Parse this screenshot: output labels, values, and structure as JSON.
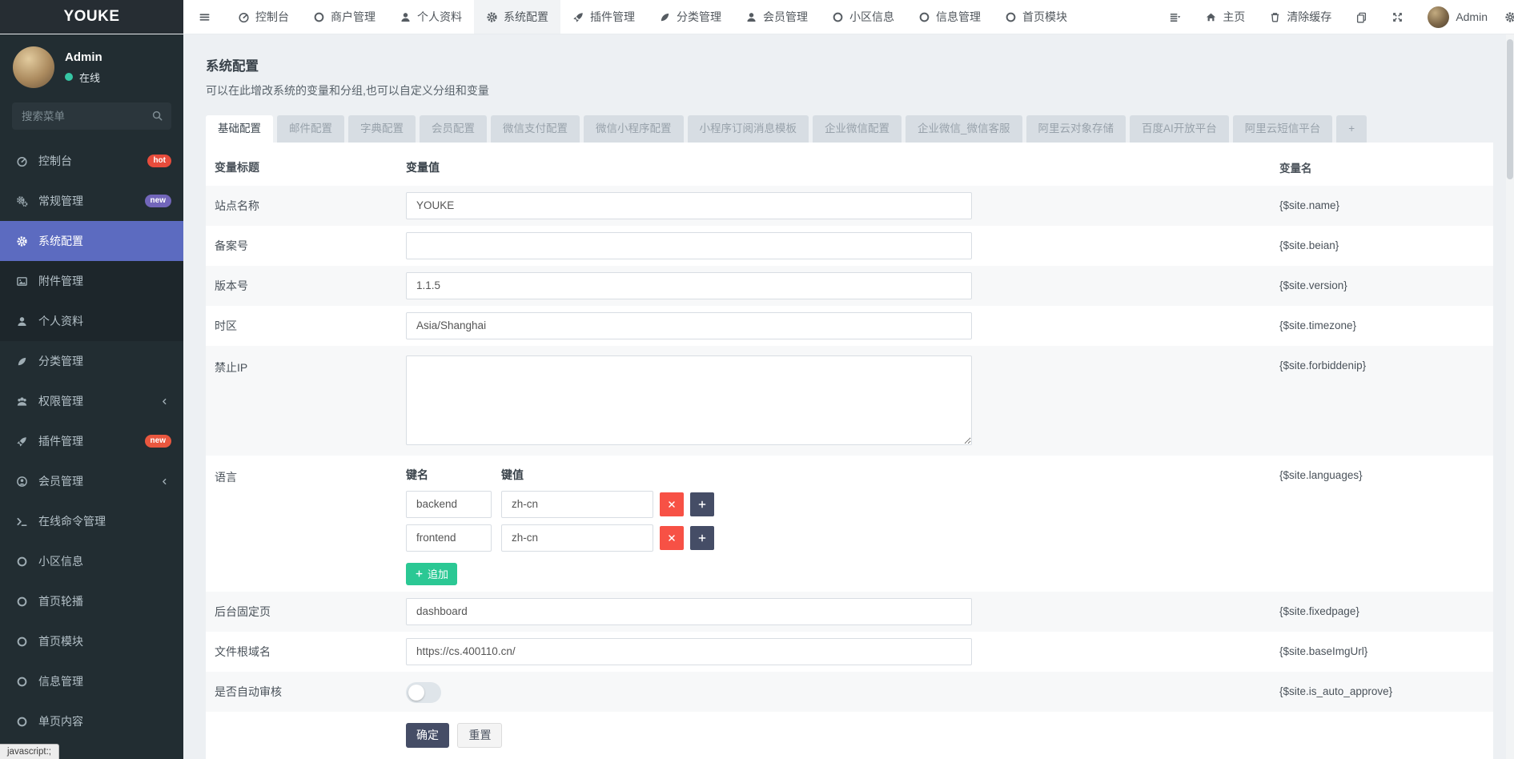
{
  "brand": {
    "title": "YOUKE"
  },
  "topnav": {
    "menu_toggle_icon": "hamburger-icon",
    "tabs": [
      {
        "label": "控制台",
        "icon": "gauge-icon",
        "active": false
      },
      {
        "label": "商户管理",
        "icon": "circle-icon",
        "active": false
      },
      {
        "label": "个人资料",
        "icon": "user-icon",
        "active": false
      },
      {
        "label": "系统配置",
        "icon": "gear-icon",
        "active": true
      },
      {
        "label": "插件管理",
        "icon": "rocket-icon",
        "active": false
      },
      {
        "label": "分类管理",
        "icon": "leaf-icon",
        "active": false
      },
      {
        "label": "会员管理",
        "icon": "user-icon",
        "active": false
      },
      {
        "label": "小区信息",
        "icon": "circle-icon",
        "active": false
      },
      {
        "label": "信息管理",
        "icon": "circle-icon",
        "active": false
      },
      {
        "label": "首页模块",
        "icon": "circle-icon",
        "active": false
      }
    ],
    "right": {
      "home_label": "主页",
      "clear_cache_label": "清除缓存",
      "username": "Admin"
    }
  },
  "sidebar": {
    "user": {
      "name": "Admin",
      "status": "在线"
    },
    "search_placeholder": "搜索菜单",
    "items": [
      {
        "label": "控制台",
        "icon": "gauge-icon",
        "badge": "hot",
        "badge_color": "#e74c3c"
      },
      {
        "label": "常规管理",
        "icon": "gears-icon",
        "badge": "new",
        "badge_color": "#7266ba"
      },
      {
        "label": "系统配置",
        "icon": "gear-icon",
        "active": true,
        "submenu": true
      },
      {
        "label": "附件管理",
        "icon": "picture-icon",
        "submenu": true
      },
      {
        "label": "个人资料",
        "icon": "user-icon",
        "submenu": true
      },
      {
        "label": "分类管理",
        "icon": "leaf-icon"
      },
      {
        "label": "权限管理",
        "icon": "users-icon",
        "chevron": true
      },
      {
        "label": "插件管理",
        "icon": "rocket-icon",
        "badge": "new",
        "badge_color": "#e9573f"
      },
      {
        "label": "会员管理",
        "icon": "user-circle-icon",
        "chevron": true
      },
      {
        "label": "在线命令管理",
        "icon": "terminal-icon"
      },
      {
        "label": "小区信息",
        "icon": "circle-icon"
      },
      {
        "label": "首页轮播",
        "icon": "circle-icon"
      },
      {
        "label": "首页模块",
        "icon": "circle-icon"
      },
      {
        "label": "信息管理",
        "icon": "circle-icon"
      },
      {
        "label": "单页内容",
        "icon": "circle-icon"
      }
    ]
  },
  "page": {
    "title": "系统配置",
    "subtitle": "可以在此增改系统的变量和分组,也可以自定义分组和变量"
  },
  "config_tabs": {
    "active_index": 0,
    "add_label": "+",
    "tabs": [
      "基础配置",
      "邮件配置",
      "字典配置",
      "会员配置",
      "微信支付配置",
      "微信小程序配置",
      "小程序订阅消息模板",
      "企业微信配置",
      "企业微信_微信客服",
      "阿里云对象存储",
      "百度AI开放平台",
      "阿里云短信平台"
    ]
  },
  "form": {
    "headers": {
      "title": "变量标题",
      "value": "变量值",
      "name": "变量名"
    },
    "rows": [
      {
        "label": "站点名称",
        "type": "input",
        "value": "YOUKE",
        "var": "{$site.name}"
      },
      {
        "label": "备案号",
        "type": "input",
        "value": "",
        "var": "{$site.beian}"
      },
      {
        "label": "版本号",
        "type": "input",
        "value": "1.1.5",
        "var": "{$site.version}"
      },
      {
        "label": "时区",
        "type": "input",
        "value": "Asia/Shanghai",
        "var": "{$site.timezone}"
      },
      {
        "label": "禁止IP",
        "type": "textarea",
        "value": "",
        "var": "{$site.forbiddenip}"
      },
      {
        "label": "语言",
        "type": "kv",
        "key_header": "键名",
        "value_header": "键值",
        "pairs": [
          {
            "key": "backend",
            "value": "zh-cn"
          },
          {
            "key": "frontend",
            "value": "zh-cn"
          }
        ],
        "append_label": "追加",
        "var": "{$site.languages}"
      },
      {
        "label": "后台固定页",
        "type": "input",
        "value": "dashboard",
        "var": "{$site.fixedpage}"
      },
      {
        "label": "文件根域名",
        "type": "input",
        "value": "https://cs.400110.cn/",
        "var": "{$site.baseImgUrl}"
      },
      {
        "label": "是否自动审核",
        "type": "toggle",
        "value": false,
        "var": "{$site.is_auto_approve}"
      }
    ],
    "submit_label": "确定",
    "reset_label": "重置"
  },
  "statusbar": {
    "text": "javascript:;"
  },
  "colors": {
    "active_menu": "#5c6bc0",
    "append_button": "#2bc894",
    "delete_button": "#f75145",
    "primary_button": "#454d66",
    "online_dot": "#36c6a4",
    "badge_hot": "#e74c3c",
    "badge_new_purple": "#7266ba",
    "badge_new_red": "#e9573f"
  }
}
